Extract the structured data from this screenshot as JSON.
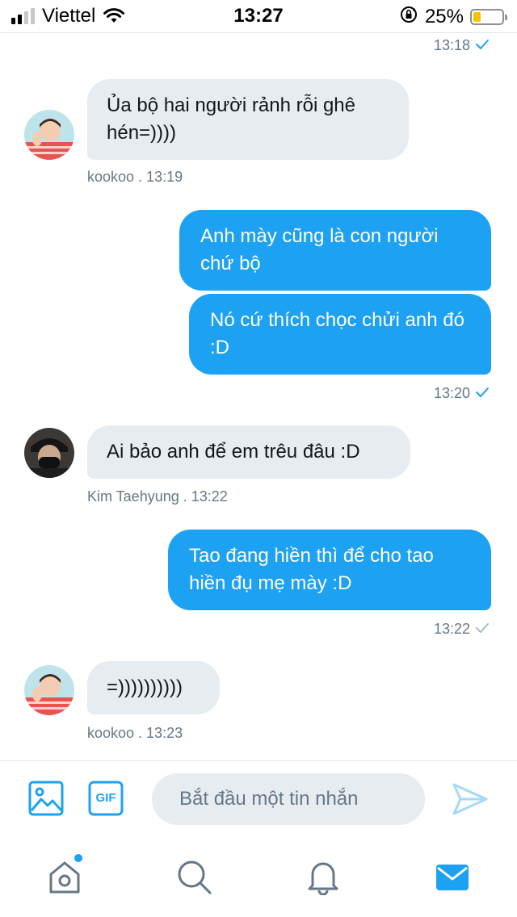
{
  "status_bar": {
    "carrier": "Viettel",
    "time": "13:27",
    "battery_percent": "25%",
    "battery_level": 0.25,
    "signal_bars": 2
  },
  "conversation": {
    "messages": [
      {
        "direction": "out",
        "time": "13:18",
        "read": true
      },
      {
        "direction": "in",
        "sender": "kookoo",
        "text": "Ủa bộ hai người rảnh rỗi ghê hén=))))",
        "meta": "kookoo  . 13:19"
      },
      {
        "direction": "out",
        "text": "Anh mày cũng là con người chứ bộ"
      },
      {
        "direction": "out",
        "text": "Nó cứ thích chọc chửi anh đó :D",
        "time": "13:20",
        "read": true
      },
      {
        "direction": "in",
        "sender": "Kim Taehyung",
        "text": "Ai bảo anh để em trêu đâu :D",
        "meta": "Kim Taehyung  . 13:22"
      },
      {
        "direction": "out",
        "text": "Tao đang hiền thì để cho tao hiền đụ mẹ mày :D",
        "time": "13:22",
        "read": false
      },
      {
        "direction": "in",
        "sender": "kookoo",
        "text": "=))))))))))",
        "meta": "kookoo  . 13:23"
      }
    ]
  },
  "composer": {
    "placeholder": "Bắt đầu một tin nhắn",
    "gif_label": "GIF"
  },
  "colors": {
    "accent": "#1da1f2",
    "incoming_bubble": "#e6ecf0",
    "meta_text": "#657786"
  }
}
